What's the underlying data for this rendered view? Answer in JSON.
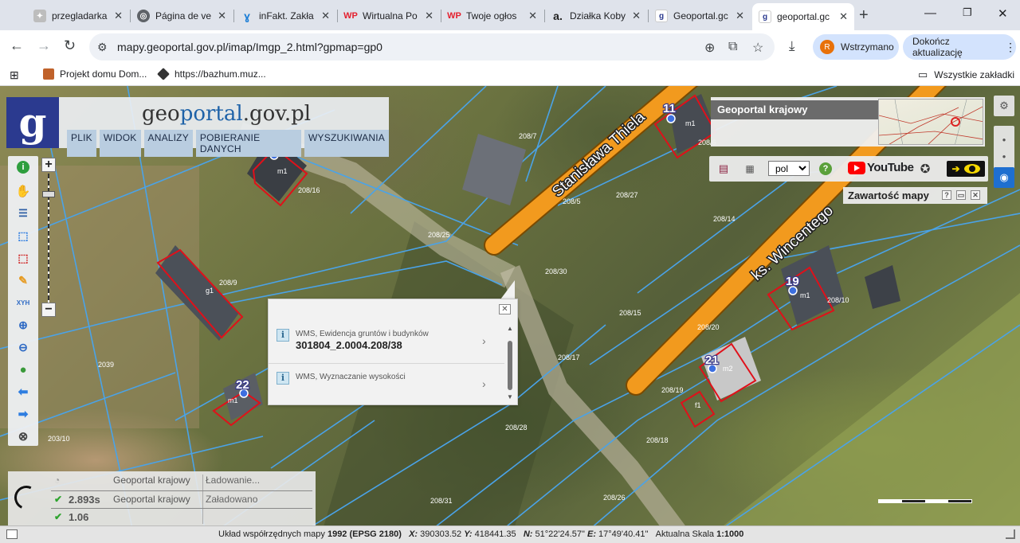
{
  "browser": {
    "tabs": [
      {
        "title": "przegladarka",
        "favicon": "eagle-icon",
        "color": "#9e9e9e"
      },
      {
        "title": "Página de ve",
        "favicon": "globe-icon",
        "color": "#5f6368"
      },
      {
        "title": "inFakt. Zakła",
        "favicon": "infakt-icon",
        "color": "#1c7ed6"
      },
      {
        "title": "Wirtualna Po",
        "favicon": "wp-icon",
        "color": "#e4202e"
      },
      {
        "title": "Twoje ogłos",
        "favicon": "wp-icon",
        "color": "#e4202e"
      },
      {
        "title": "Działka Koby",
        "favicon": "a-icon",
        "color": "#222222"
      },
      {
        "title": "Geoportal.gc",
        "favicon": "geoportal-icon",
        "color": "#2b3a8f"
      },
      {
        "title": "geoportal.gc",
        "favicon": "geoportal-icon",
        "color": "#2b3a8f"
      }
    ],
    "new_tab": "+",
    "url": "mapy.geoportal.gov.pl/imap/Imgp_2.html?gpmap=gp0",
    "profile_initial": "R",
    "profile_label": "Wstrzymano",
    "update_label": "Dokończ aktualizację",
    "bookmarks": [
      {
        "label": "Projekt domu Dom..."
      },
      {
        "label": "https://bazhum.muz..."
      }
    ],
    "all_bookmarks": "Wszystkie zakładki"
  },
  "app": {
    "logo_prefix": "geo",
    "logo_main": "portal",
    "logo_suffix": ".gov.pl",
    "menu": [
      "PLIK",
      "WIDOK",
      "ANALIZY",
      "POBIERANIE DANYCH",
      "WYSZUKIWANIA"
    ],
    "mini_map_title": "Geoportal krajowy",
    "language": "pol",
    "youtube": "YouTube",
    "map_contents": "Zawartość mapy"
  },
  "map": {
    "street_labels": [
      "Stanisława Thiela",
      "ks. Wincentego"
    ],
    "house_numbers": [
      "11",
      "19",
      "21",
      "22"
    ],
    "parcel_labels": [
      "208/16",
      "208/7",
      "208/6",
      "208/14",
      "208/25",
      "208/30",
      "208/9",
      "208/15",
      "208/17",
      "2039",
      "208/19",
      "208/10",
      "208/27",
      "208/31",
      "208/28",
      "208/26",
      "208/18",
      "203/10",
      "208/20",
      "208/5"
    ],
    "building_labels": [
      "m1",
      "m1",
      "g1",
      "m1",
      "m1",
      "m2",
      "f1"
    ],
    "scale_label": "1:1000"
  },
  "popup": {
    "items": [
      {
        "source": "WMS, Ewidencja gruntów i budynków",
        "value": "301804_2.0004.208/38"
      },
      {
        "source": "WMS, Wyznaczanie wysokości",
        "value": ""
      }
    ]
  },
  "loader": {
    "rows": [
      {
        "time": "",
        "source": "Geoportal krajowy",
        "status": "Ładowanie..."
      },
      {
        "time": "2.893s",
        "source": "Geoportal krajowy",
        "status": "Załadowano"
      },
      {
        "time": "1.06",
        "source": "",
        "status": ""
      }
    ]
  },
  "status": {
    "crs_label": "Układ współrzędnych mapy",
    "crs_value": "1992 (EPSG 2180)",
    "x_label": "X:",
    "x_value": "390303.52",
    "y_label": "Y:",
    "y_value": "418441.35",
    "n_label": "N:",
    "n_value": "51°22'24.57\"",
    "e_label": "E:",
    "e_value": "17°49'40.41\"",
    "scale_label": "Aktualna Skala",
    "scale_value": "1:1000"
  },
  "colors": {
    "road": "#f29a1e",
    "parcel_line": "#4aa3e8",
    "building_line": "#e0101a",
    "logo_bg": "#2b3a8f"
  }
}
